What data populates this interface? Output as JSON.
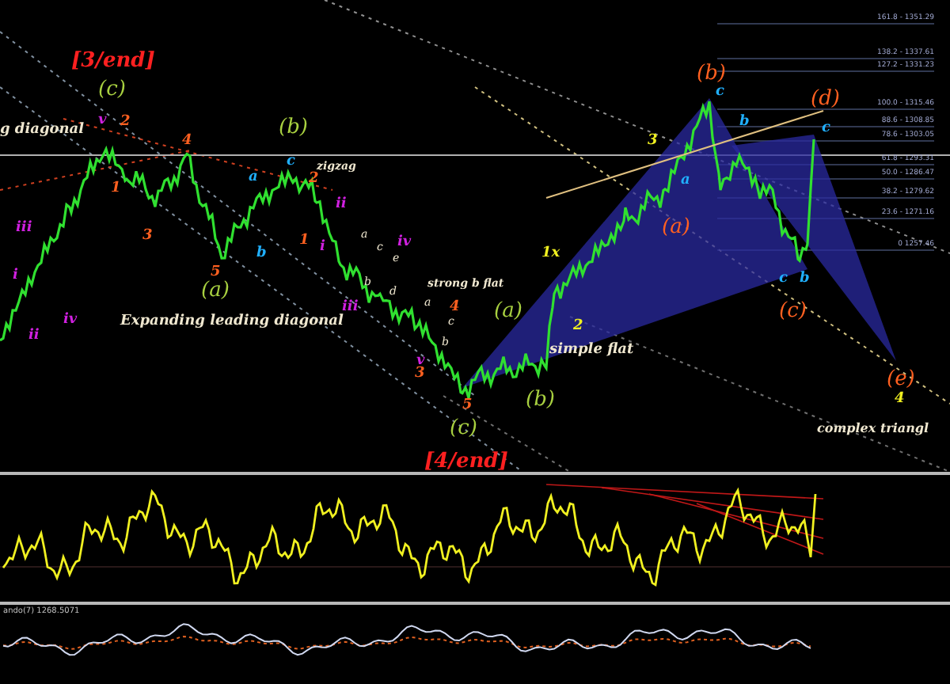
{
  "chart": {
    "labels": [
      {
        "text": "[3/end]",
        "kind": "end",
        "color": "#ff2020"
      },
      {
        "text": "(c)",
        "kind": "wave",
        "color": "#a8d040"
      },
      {
        "text": "g diagonal",
        "kind": "note",
        "color": "#f0e8d0"
      },
      {
        "text": "v",
        "kind": "minor",
        "color": "#d020e0"
      },
      {
        "text": "2",
        "kind": "minor",
        "color": "#ff6020"
      },
      {
        "text": "4",
        "kind": "minor",
        "color": "#ff6020"
      },
      {
        "text": "(b)",
        "kind": "wave",
        "color": "#a8d040"
      },
      {
        "text": "zigzag",
        "kind": "small",
        "color": "#f0e8d0"
      },
      {
        "text": "a",
        "kind": "minor",
        "color": "#20b0ff"
      },
      {
        "text": "c",
        "kind": "minor",
        "color": "#20b0ff"
      },
      {
        "text": "2",
        "kind": "minor",
        "color": "#ff6020"
      },
      {
        "text": "ii",
        "kind": "minor",
        "color": "#d020e0"
      },
      {
        "text": "1",
        "kind": "minor",
        "color": "#ff6020"
      },
      {
        "text": "3",
        "kind": "minor",
        "color": "#ff6020"
      },
      {
        "text": "iii",
        "kind": "minor",
        "color": "#d020e0"
      },
      {
        "text": "i",
        "kind": "minor",
        "color": "#d020e0"
      },
      {
        "text": "iv",
        "kind": "minor",
        "color": "#d020e0"
      },
      {
        "text": "ii",
        "kind": "minor",
        "color": "#d020e0"
      },
      {
        "text": "5",
        "kind": "minor",
        "color": "#ff6020"
      },
      {
        "text": "b",
        "kind": "minor",
        "color": "#20b0ff"
      },
      {
        "text": "(a)",
        "kind": "wave",
        "color": "#a8d040"
      },
      {
        "text": "Expanding leading diagonal",
        "kind": "note",
        "color": "#f0e8d0"
      },
      {
        "text": "1",
        "kind": "minor",
        "color": "#ff6020"
      },
      {
        "text": "i",
        "kind": "minor",
        "color": "#d020e0"
      },
      {
        "text": "iii",
        "kind": "minor",
        "color": "#d020e0"
      },
      {
        "text": "a",
        "kind": "tiny",
        "color": "#f0e8d0"
      },
      {
        "text": "c",
        "kind": "tiny",
        "color": "#f0e8d0"
      },
      {
        "text": "e",
        "kind": "tiny",
        "color": "#f0e8d0"
      },
      {
        "text": "iv",
        "kind": "minor",
        "color": "#d020e0"
      },
      {
        "text": "b",
        "kind": "tiny",
        "color": "#f0e8d0"
      },
      {
        "text": "d",
        "kind": "tiny",
        "color": "#f0e8d0"
      },
      {
        "text": "strong b flat",
        "kind": "small",
        "color": "#f0e8d0"
      },
      {
        "text": "a",
        "kind": "tiny",
        "color": "#f0e8d0"
      },
      {
        "text": "4",
        "kind": "minor",
        "color": "#ff6020"
      },
      {
        "text": "c",
        "kind": "tiny",
        "color": "#f0e8d0"
      },
      {
        "text": "v",
        "kind": "minor",
        "color": "#d020e0"
      },
      {
        "text": "b",
        "kind": "tiny",
        "color": "#f0e8d0"
      },
      {
        "text": "3",
        "kind": "minor",
        "color": "#ff6020"
      },
      {
        "text": "5",
        "kind": "minor",
        "color": "#ff6020"
      },
      {
        "text": "(c)",
        "kind": "wave",
        "color": "#a8d040"
      },
      {
        "text": "[4/end]",
        "kind": "end",
        "color": "#ff2020"
      },
      {
        "text": "(a)",
        "kind": "wave",
        "color": "#a8d040"
      },
      {
        "text": "simple flat",
        "kind": "note",
        "color": "#f0e8d0"
      },
      {
        "text": "(b)",
        "kind": "wave",
        "color": "#a8d040"
      },
      {
        "text": "2",
        "kind": "minor",
        "color": "#f0f020"
      },
      {
        "text": "1x",
        "kind": "minor",
        "color": "#f0f020"
      },
      {
        "text": "3",
        "kind": "minor",
        "color": "#f0f020"
      },
      {
        "text": "(b)",
        "kind": "wave",
        "color": "#ff6020"
      },
      {
        "text": "c",
        "kind": "minor",
        "color": "#20b0ff"
      },
      {
        "text": "b",
        "kind": "minor",
        "color": "#20b0ff"
      },
      {
        "text": "a",
        "kind": "minor",
        "color": "#20b0ff"
      },
      {
        "text": "(a)",
        "kind": "wave",
        "color": "#ff6020"
      },
      {
        "text": "(d)",
        "kind": "wave",
        "color": "#ff6020"
      },
      {
        "text": "c",
        "kind": "minor",
        "color": "#20b0ff"
      },
      {
        "text": "c",
        "kind": "minor",
        "color": "#20b0ff"
      },
      {
        "text": "b",
        "kind": "minor",
        "color": "#20b0ff"
      },
      {
        "text": "(c)",
        "kind": "wave",
        "color": "#ff6020"
      },
      {
        "text": "(e)",
        "kind": "wave",
        "color": "#ff6020"
      },
      {
        "text": "4",
        "kind": "minor",
        "color": "#f0f020"
      },
      {
        "text": "complex triangl",
        "kind": "edge",
        "color": "#f0e8d0"
      }
    ],
    "fib_levels": [
      "161.8 - 1351.29",
      "138.2 - 1337.61",
      "127.2 - 1331.23",
      "100.0 - 1315.46",
      "88.6 - 1308.85",
      "78.6 - 1303.05",
      "61.8 - 1293.31",
      "50.0 - 1286.47",
      "38.2 - 1279.62",
      "23.6 - 1271.16",
      "0 1257.46"
    ]
  },
  "indicator": {
    "label": "ando(7) 1268.5071"
  }
}
